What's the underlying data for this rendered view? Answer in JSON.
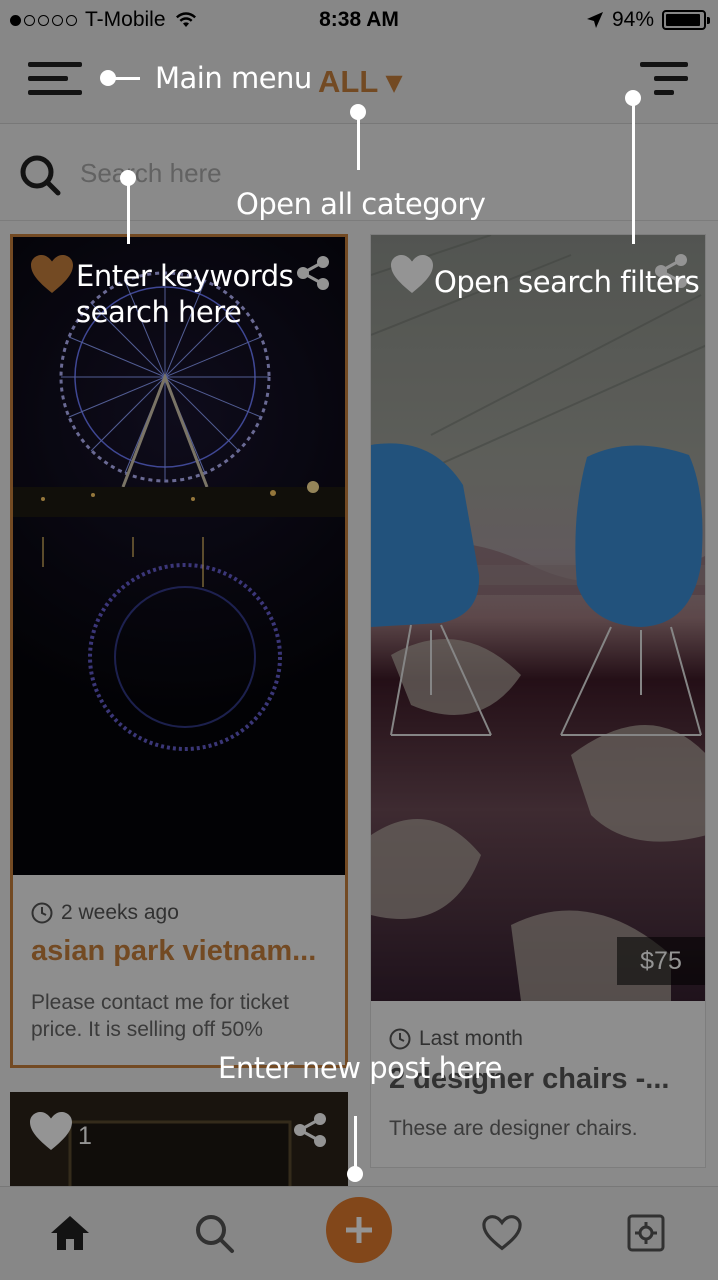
{
  "status_bar": {
    "carrier": "T-Mobile",
    "time": "8:38 AM",
    "battery_percent": "94%",
    "signal_bars_filled": 1,
    "signal_bars_total": 5,
    "battery_level": 0.94
  },
  "header": {
    "category_label": "ALL ▾",
    "menu_icon": "hamburger-menu-icon",
    "filter_icon": "filter-funnel-icon"
  },
  "search": {
    "placeholder": "Search here"
  },
  "cards": [
    {
      "time_ago": "2 weeks ago",
      "title": "asian park vietnam...",
      "description": "Please contact me for ticket price. It is selling off 50%",
      "liked": true
    },
    {
      "time_ago": "Last month",
      "title": "2 designer chairs -...",
      "description": "These are designer chairs.",
      "price": "$75",
      "liked": false
    },
    {
      "like_count": "1",
      "liked": false
    }
  ],
  "bottom_nav": {
    "items": [
      "home-icon",
      "search-icon",
      "add-icon",
      "heart-icon",
      "settings-icon"
    ]
  },
  "coach_marks": {
    "main_menu": "Main menu",
    "open_category": "Open all category",
    "search_keywords": "Enter keywords search here",
    "search_filters": "Open search filters",
    "new_post": "Enter new post here"
  },
  "colors": {
    "accent": "#c7803d",
    "add_button": "#e07a2e",
    "overlay": "rgba(0,0,0,0.42)"
  }
}
